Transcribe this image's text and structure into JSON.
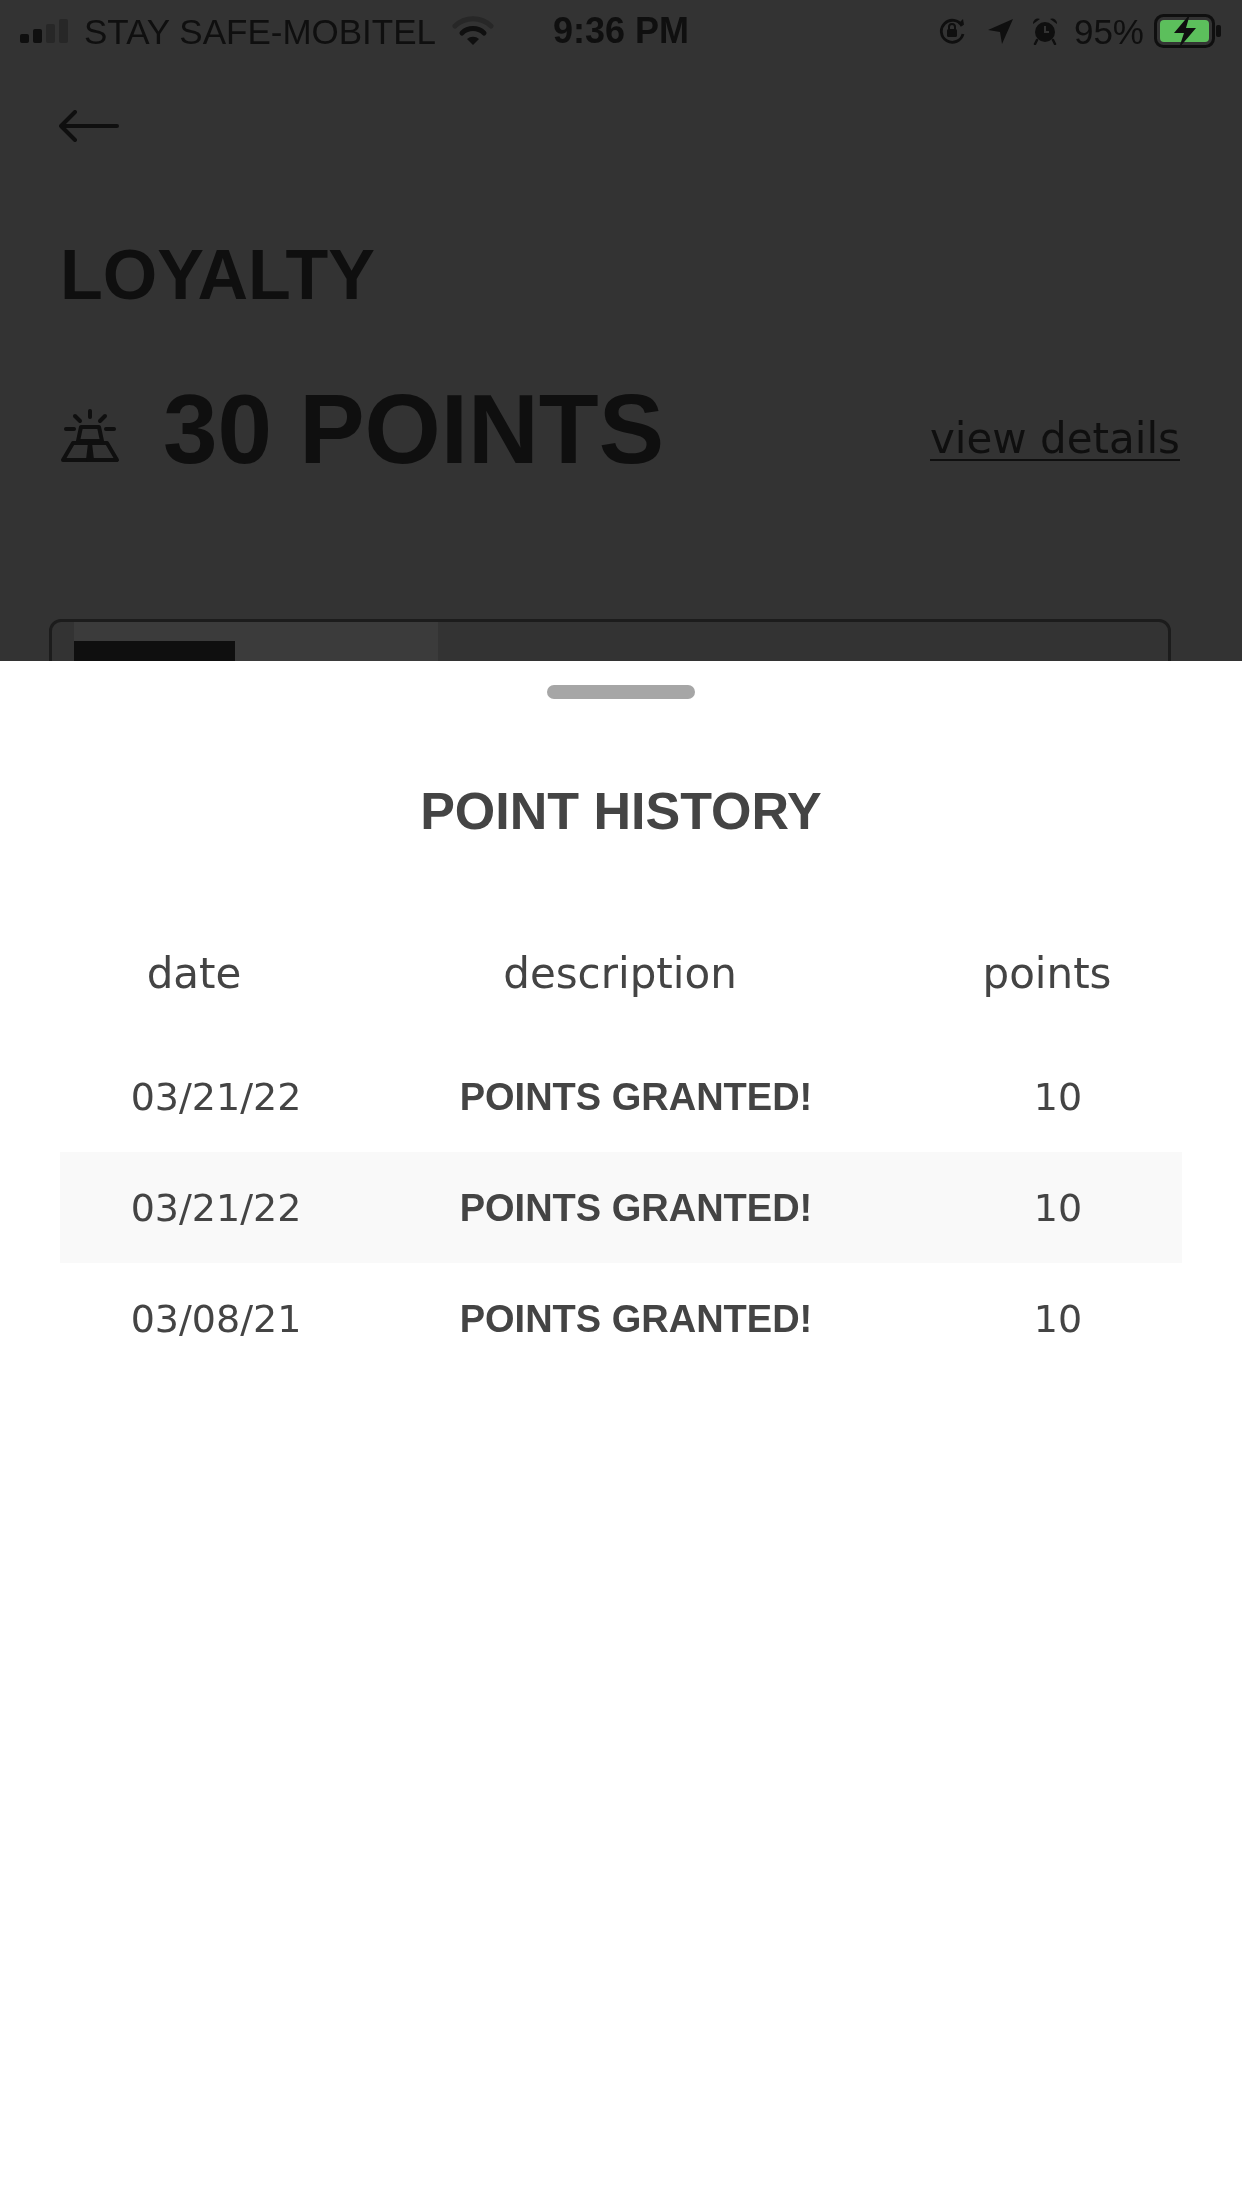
{
  "status_bar": {
    "carrier": "STAY SAFE-MOBITEL",
    "time": "9:36 PM",
    "battery_percent": "95%",
    "charging": true
  },
  "header": {
    "title": "LOYALTY",
    "points_balance": "30 POINTS",
    "details_link": "view details"
  },
  "point_history": {
    "title": "POINT HISTORY",
    "columns": [
      "date",
      "description",
      "points"
    ],
    "rows": [
      {
        "date": "03/21/22",
        "description": "POINTS GRANTED!",
        "points": "10"
      },
      {
        "date": "03/21/22",
        "description": "POINTS GRANTED!",
        "points": "10"
      },
      {
        "date": "03/08/21",
        "description": "POINTS GRANTED!",
        "points": "10"
      }
    ]
  }
}
